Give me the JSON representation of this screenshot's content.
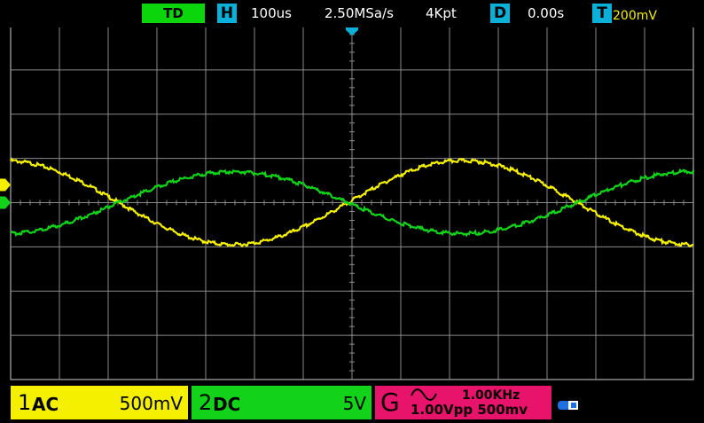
{
  "topbar": {
    "trigger_mode": "TD",
    "horizontal_key": "H",
    "timebase": "100us",
    "sample_rate": "2.50MSa/s",
    "memory_depth": "4Kpt",
    "delay_key": "D",
    "delay": "0.00s",
    "trigger_key": "T",
    "trigger_level": "200mV"
  },
  "channels": {
    "ch1": {
      "number": "1",
      "coupling": "AC",
      "scale": "500mV"
    },
    "ch2": {
      "number": "2",
      "coupling": "DC",
      "scale": "5V"
    },
    "generator": {
      "label": "G",
      "frequency": "1.00KHz",
      "amplitude": "1.00Vpp",
      "offset": "500mv"
    }
  },
  "colors": {
    "ch1": "#f4f000",
    "ch2": "#12d21a",
    "generator": "#e8136a",
    "grid": "#8a8a8a",
    "accent": "#0ab0d8"
  },
  "chart_data": {
    "type": "line",
    "grid": true,
    "x_divisions": 14,
    "y_divisions": 8,
    "xlim_div": [
      0,
      14
    ],
    "ylim_div": [
      -4,
      4
    ],
    "series": [
      {
        "name": "CH1",
        "color": "#f4f000",
        "amplitude_div": 0.95,
        "offset_div": 0.0,
        "period_div": 9.4,
        "phase_deg": 95
      },
      {
        "name": "CH2",
        "color": "#12d21a",
        "amplitude_div": 0.7,
        "offset_div": 0.0,
        "period_div": 9.4,
        "phase_deg": 275
      }
    ]
  }
}
